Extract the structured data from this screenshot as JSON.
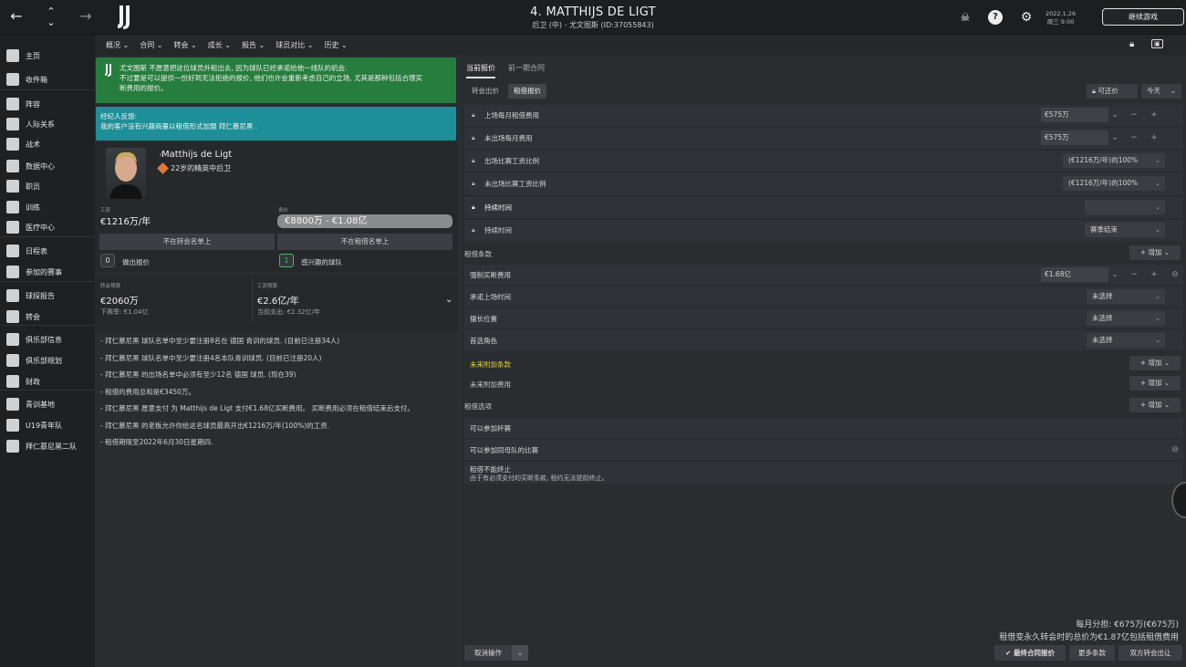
{
  "topbar": {
    "title": "4. MATTHIJS DE LIGT",
    "subtitle": "后卫 (中) - 尤文图斯 (ID:37055843)",
    "date_line1": "2022.1.26",
    "date_line2": "周三 9:00",
    "continue_label": "继续游戏",
    "icons": [
      "back-arrow-icon",
      "up-down-icon",
      "forward-arrow-icon",
      "juventus-logo",
      "skull-icon",
      "help-icon",
      "gear-icon"
    ]
  },
  "sidebar": {
    "items": [
      {
        "label": "主页",
        "icon": "home-icon"
      },
      {
        "label": "收件箱",
        "icon": "inbox-icon"
      },
      {
        "label": "阵容",
        "icon": "shirt-icon"
      },
      {
        "label": "人际关系",
        "icon": "relations-icon"
      },
      {
        "label": "战术",
        "icon": "tactics-icon"
      },
      {
        "label": "数据中心",
        "icon": "data-icon"
      },
      {
        "label": "职员",
        "icon": "staff-icon"
      },
      {
        "label": "训练",
        "icon": "training-icon"
      },
      {
        "label": "医疗中心",
        "icon": "medical-icon"
      },
      {
        "label": "日程表",
        "icon": "calendar-icon"
      },
      {
        "label": "参加的赛事",
        "icon": "trophy-icon"
      },
      {
        "label": "球探报告",
        "icon": "scout-icon"
      },
      {
        "label": "转会",
        "icon": "transfer-icon"
      },
      {
        "label": "俱乐部信息",
        "icon": "shield-icon"
      },
      {
        "label": "俱乐部规划",
        "icon": "plan-icon"
      },
      {
        "label": "财政",
        "icon": "finance-icon"
      },
      {
        "label": "青训基地",
        "icon": "youth-icon"
      },
      {
        "label": "U19青年队",
        "icon": "u19-icon"
      },
      {
        "label": "拜仁慕尼黑二队",
        "icon": "team-b-icon"
      }
    ]
  },
  "subnav": {
    "items": [
      "概况 ⌄",
      "合同 ⌄",
      "转会 ⌄",
      "成长 ⌄",
      "报告 ⌄",
      "球员对比 ⌄",
      "历史 ⌄"
    ]
  },
  "left": {
    "green_msg": [
      "尤文图斯 不愿意把这位球员外租出去, 因为球队已经承诺给他一线队的机会.",
      "不过要是可以提供一份好到无法拒绝的报价, 他们也许会重新考虑自己的立场, 尤其是那种包括合理买",
      "断费用的报价。"
    ],
    "teal_title": "经纪人反馈:",
    "teal_msg": "我的客户没有兴趣商量以租借形式加盟 拜仁慕尼黑 .",
    "player_name": "Matthijs de Ligt",
    "player_desc": "22岁的精英中后卫",
    "wage_label": "工资",
    "wage_value": "€1216万/年",
    "value_label": "身价",
    "value_value": "€8800万 - €1.08亿",
    "btn_transfer_list": "不在转会名单上",
    "btn_loan_list": "不在租借名单上",
    "bids_count": "0",
    "bids_label": "做出报价",
    "interested_count": "1",
    "interested_label": "感兴趣的球队",
    "transfer_budget_label": "转会预算",
    "transfer_budget_value": "€2060万",
    "transfer_budget_sub": "下赛季: €1.04亿",
    "wage_budget_label": "工资预算",
    "wage_budget_value": "€2.6亿/年",
    "wage_budget_sub": "当前支出: €2.32亿/年",
    "notes": [
      "- 拜仁慕尼黑 球队名单中至少要注册8名在 德国 青训的球员. (目前已注册34人)",
      "- 拜仁慕尼黑 球队名单中至少要注册4名本队青训球员. (目前已注册20人)",
      "- 拜仁慕尼黑 的出场名单中必须有至少12名 德国 球员. (现在39)",
      "- 租借的费用总和是€3450万。",
      "- 拜仁慕尼黑 愿意支付 为 Matthijs de Ligt 支付€1.68亿买断费用。 买断费用必须在租借结束后支付。",
      "- 拜仁慕尼黑 的老板允许你给这名球员最高开出€1216万/年(100%)的工资.",
      "- 租借期限至2022年6月30日星期四."
    ]
  },
  "right": {
    "tab_current": "当前报价",
    "tab_previous": "前一期合同",
    "seg_transfer": "转会出价",
    "seg_loan": "租借报价",
    "negotiable": "可还价",
    "today": "今天",
    "rows": [
      {
        "label": "上场每月租借费用",
        "value": "€575万"
      },
      {
        "label": "未出场每月费用",
        "value": "€575万"
      },
      {
        "label": "出场比赛工资比例",
        "value": "(€1216万/年)的100%"
      },
      {
        "label": "未出场比赛工资比例",
        "value": "(€1216万/年)的100%"
      },
      {
        "label": "持续时间",
        "value": ""
      },
      {
        "label": "持续时间",
        "value": "赛季结束"
      }
    ],
    "loan_terms_label": "租借条款",
    "add_label": "增加",
    "terms": [
      {
        "label": "强制买断费用",
        "value": "€1.68亿"
      },
      {
        "label": "承诺上场时间",
        "value": "未选择"
      },
      {
        "label": "擅长位置",
        "value": "未选择"
      },
      {
        "label": "首选角色",
        "value": "未选择"
      }
    ],
    "future_clauses": "未来附加条款",
    "future_fees": "未来附加费用",
    "loan_options_label": "租借选项",
    "option_cup": "可以参加杯赛",
    "option_same_league": "可以参加同母队的比赛",
    "cannot_terminate": "租借不能终止",
    "cannot_terminate_sub": "由于有必须支付的买断条款, 租约无法提前终止。",
    "monthly_share": "每月分担: €675万(€675万)",
    "total_line": "租借变永久转会时的总价为€1.87亿包括租借费用",
    "cancel_label": "取消操作",
    "final_contract": "最终合同报价",
    "more_terms": "更多条款",
    "trade_label": "双方转会出让"
  },
  "colors": {
    "green": "#267d3d",
    "teal": "#1c8f98",
    "accent_yellow": "#e6d23a"
  }
}
